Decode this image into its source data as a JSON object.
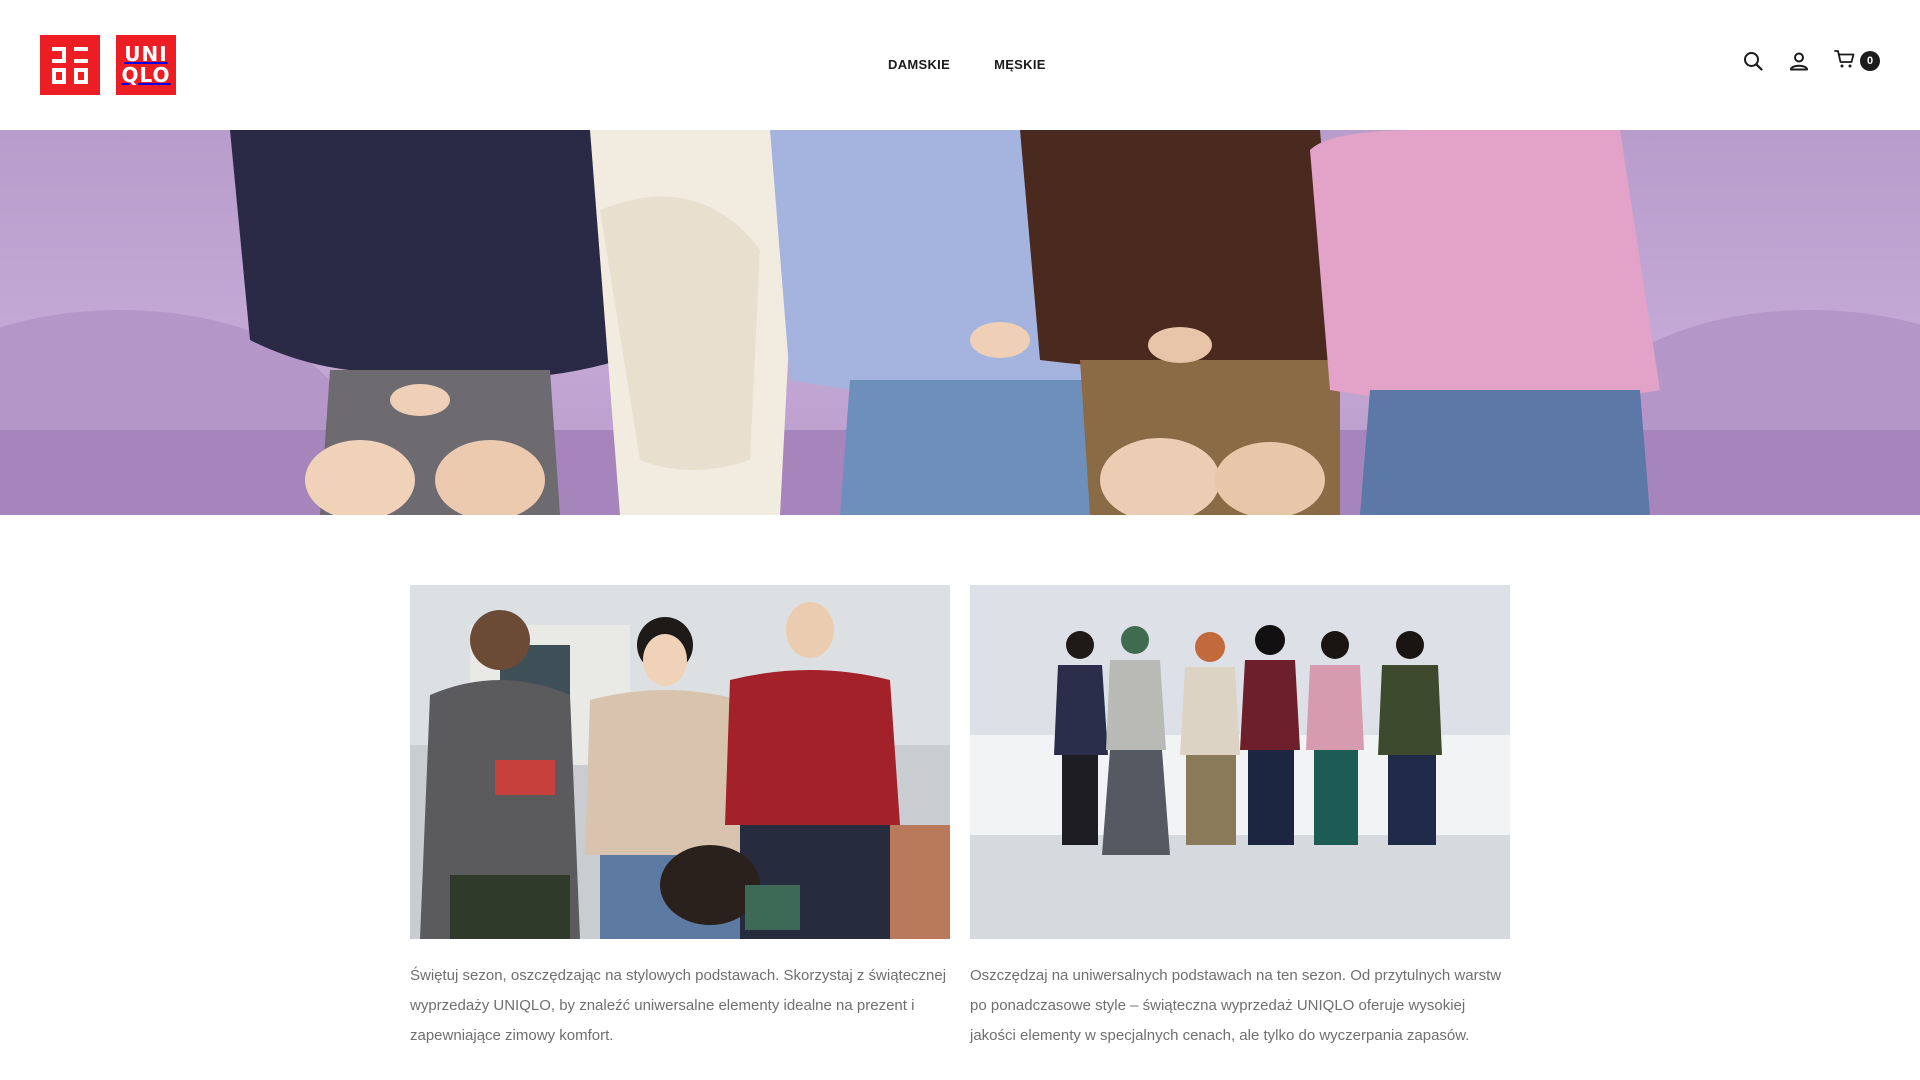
{
  "brand": {
    "name": "UNIQLO",
    "logo_top": "UNI",
    "logo_bottom": "QLO",
    "color": "#ed1d24"
  },
  "nav": {
    "items": [
      {
        "label": "DAMSKIE"
      },
      {
        "label": "MĘSKIE"
      }
    ]
  },
  "header_icons": {
    "search": "search-icon",
    "account": "user-icon",
    "cart": "cart-icon",
    "cart_count": "0"
  },
  "hero": {
    "description_icon": "hero-banner-image",
    "colors": [
      "#2a2a47",
      "#f1ebe0",
      "#a5b4de",
      "#4a2a1e",
      "#e3a2c7"
    ]
  },
  "cards": [
    {
      "image": "holiday-gift-image",
      "text": "Świętuj sezon, oszczędzając na stylowych podstawach. Skorzystaj z świątecznej wyprzedaży UNIQLO, by znaleźć uniwersalne elementy idealne na prezent i zapewniające zimowy komfort."
    },
    {
      "image": "ice-rink-group-image",
      "text": "Oszczędzaj na uniwersalnych podstawach na ten sezon. Od przytulnych warstw po ponadczasowe style – świąteczna wyprzedaż UNIQLO oferuje wysokiej jakości elementy w specjalnych cenach, ale tylko do wyczerpania zapasów."
    }
  ]
}
